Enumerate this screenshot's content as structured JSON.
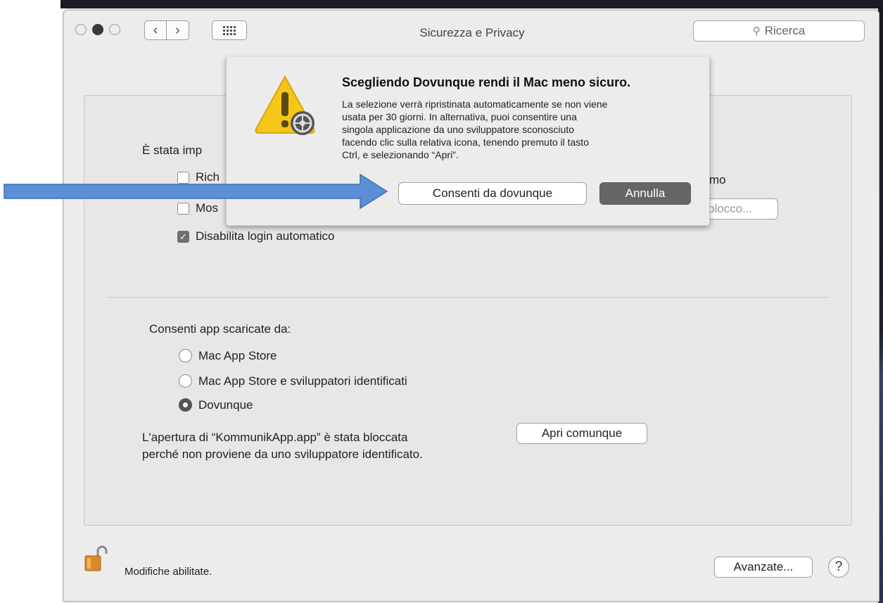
{
  "window": {
    "title": "Sicurezza e Privacy",
    "search_placeholder": "Ricerca"
  },
  "general": {
    "intro_partial": "È stata imp",
    "checkboxes": [
      {
        "label_partial": "Rich",
        "checked": false
      },
      {
        "label_partial": "Mos",
        "checked": false
      },
      {
        "label": "Disabilita login automatico",
        "checked": true
      }
    ],
    "right_text_partial": "mo",
    "right_button_partial": "blocco..."
  },
  "apps": {
    "heading": "Consenti app scaricate da:",
    "options": [
      {
        "label": "Mac App Store",
        "selected": false
      },
      {
        "label": "Mac App Store e sviluppatori identificati",
        "selected": false
      },
      {
        "label": "Dovunque",
        "selected": true
      }
    ],
    "blocked_line1": "L'apertura di “KommunikApp.app” è stata bloccata",
    "blocked_line2": "perché non proviene da uno sviluppatore identificato.",
    "open_anyway_button": "Apri comunque"
  },
  "footer": {
    "lock_text": "Modifiche abilitate.",
    "advanced_button": "Avanzate...",
    "help_button": "?"
  },
  "sheet": {
    "title": "Scegliendo Dovunque rendi il Mac meno sicuro.",
    "body": [
      "La selezione verrà ripristinata automaticamente se non viene",
      "usata per 30 giorni. In alternativa, puoi consentire una",
      "singola applicazione da uno sviluppatore sconosciuto",
      "facendo clic sulla relativa icona, tenendo premuto il tasto",
      "Ctrl, e selezionando “Apri”."
    ],
    "allow_button": "Consenti da dovunque",
    "cancel_button": "Annulla"
  },
  "colors": {
    "arrow_fill": "#5b8fd6",
    "cancel_button_bg": "#666666",
    "window_bg": "#ececec"
  },
  "icons": [
    "search-icon",
    "back-chevron-icon",
    "forward-chevron-icon",
    "grid-icon",
    "warning-gear-icon",
    "unlocked-padlock-icon",
    "help-icon",
    "annotation-arrow-icon"
  ]
}
